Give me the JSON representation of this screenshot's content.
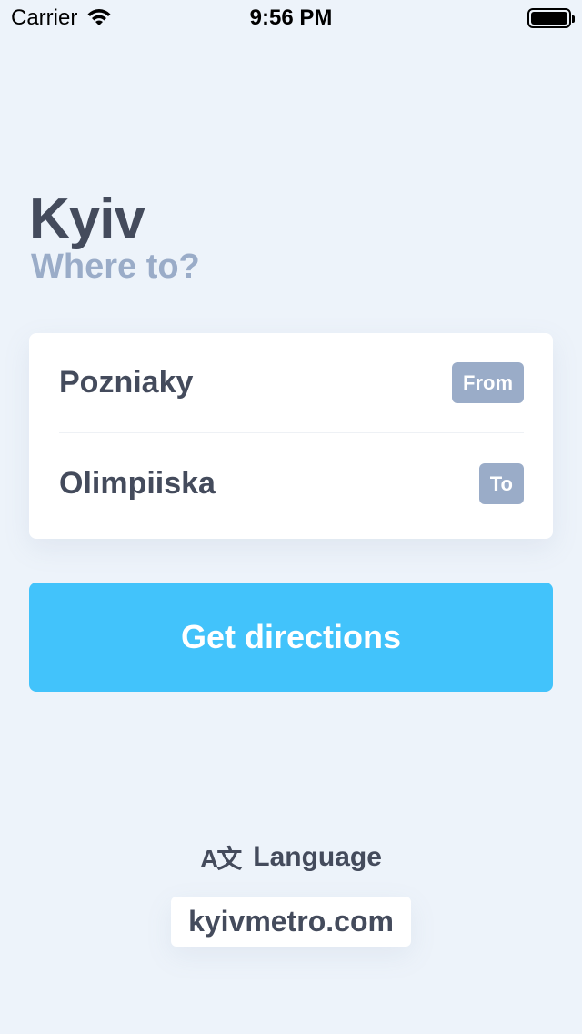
{
  "status_bar": {
    "carrier": "Carrier",
    "time": "9:56 PM",
    "wifi_icon": "wifi-icon",
    "battery_icon": "battery-icon"
  },
  "header": {
    "city": "Kyiv",
    "subtitle": "Where to?"
  },
  "route": {
    "from": {
      "station": "Pozniaky",
      "tag": "From"
    },
    "to": {
      "station": "Olimpiiska",
      "tag": "To"
    }
  },
  "actions": {
    "get_directions_label": "Get directions"
  },
  "footer": {
    "language_icon": "translate-icon",
    "language_label": "Language",
    "website": "kyivmetro.com"
  },
  "colors": {
    "background": "#edf3fa",
    "text": "#444b5c",
    "muted": "#9aacc8",
    "accent": "#42c3fb",
    "card": "#ffffff"
  }
}
